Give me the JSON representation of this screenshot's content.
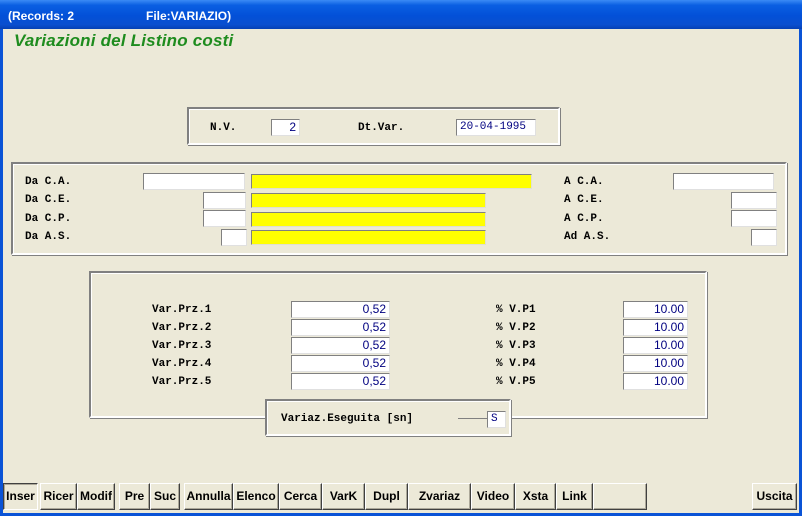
{
  "titlebar": {
    "records": "(Records: 2",
    "file": "File:VARIAZIO)"
  },
  "form_title": "Variazioni del Listino costi",
  "header_box": {
    "nv_label": "N.V.",
    "nv_value": "2",
    "dtvar_label": "Dt.Var.",
    "dtvar_value": "20-04-1995"
  },
  "range_box": {
    "da_ca": "Da C.A.",
    "da_ce": "Da C.E.",
    "da_cp": "Da C.P.",
    "da_as": "Da A.S.",
    "a_ca": "A C.A.",
    "a_ce": "A C.E.",
    "a_cp": "A C.P.",
    "ad_as": "Ad A.S."
  },
  "prices": {
    "rows": [
      {
        "label": "Var.Prz.1",
        "value": "0,52",
        "pct_label": "% V.P1",
        "pct": "10.00"
      },
      {
        "label": "Var.Prz.2",
        "value": "0,52",
        "pct_label": "% V.P2",
        "pct": "10.00"
      },
      {
        "label": "Var.Prz.3",
        "value": "0,52",
        "pct_label": "% V.P3",
        "pct": "10.00"
      },
      {
        "label": "Var.Prz.4",
        "value": "0,52",
        "pct_label": "% V.P4",
        "pct": "10.00"
      },
      {
        "label": "Var.Prz.5",
        "value": "0,52",
        "pct_label": "% V.P5",
        "pct": "10.00"
      }
    ],
    "eseguita_label": "Variaz.Eseguita [sn]",
    "eseguita_value": "S"
  },
  "toolbar": {
    "inser": "Inser",
    "ricer": "Ricer",
    "modif": "Modif",
    "pre": "Pre",
    "suc": "Suc",
    "annulla": "Annulla",
    "elenco": "Elenco",
    "cerca": "Cerca",
    "vark": "VarK",
    "dupl": "Dupl",
    "zvariaz": "Zvariaz",
    "video": "Video",
    "xsta": "Xsta",
    "link": "Link",
    "blank": "",
    "uscita": "Uscita"
  }
}
